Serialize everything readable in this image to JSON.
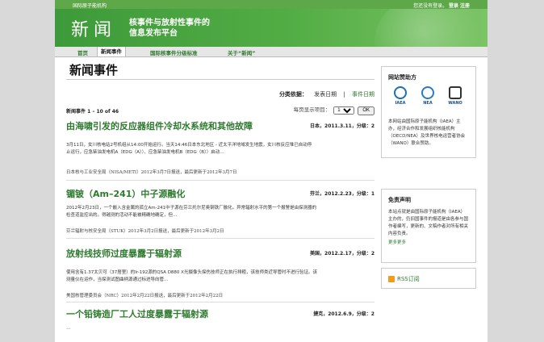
{
  "topbar": {
    "left_label": "国际原子能机构",
    "right_prefix": "您还没有登录。",
    "login": "登录",
    "register": "注册"
  },
  "banner": {
    "title": "新闻",
    "subtitle_line1": "核事件与放射性事件的",
    "subtitle_line2": "信息发布平台"
  },
  "nav": {
    "items": [
      "首页",
      "新闻事件",
      "国际核事件分级标准",
      "关于“新闻”"
    ],
    "active_index": 1
  },
  "main": {
    "heading": "新闻事件",
    "sort_label": "分类依据：",
    "sort_options": [
      "发表日期",
      "|",
      "事件日期"
    ],
    "count_text": "新闻事件 1 – 10 of 46",
    "per_page_label": "每页显示项目：",
    "per_page_value": "10",
    "ok_label": "OK",
    "items": [
      {
        "title": "由海啸引发的反应器组件冷却水系统和其他故障",
        "meta": "日本，2011.3.11，分级：2",
        "body_line1": "3月11日，女川核电站2号机组从14:00开始运行。当天14:46日本东北地区 - 近太平洋地域发生地震，女川核反应堆已自动停",
        "body_line2": "止运行，应急柴油发电机A（EDG（A））、应急柴油发电机B（EDG（B））启动…",
        "source": "日本核与工业安全局（NISA/METI）2012年3月7日报送，最后更新于2012年3月7日"
      },
      {
        "title": "镅铍（Am–241）中子源融化",
        "meta": "芬兰，2012.2.23，分级：1",
        "body_line1": "2012年2月23日，一个嵌入含金属的孤立Am-241中子源在芬兰托尔尼奥钢铁厂融化。异常辐射水平的第一个报警是由探测器的",
        "body_line2": "检查道监控出的。得越测的活动不能被精确地确定，但…",
        "source": "芬兰辐射与核安全局（STUK）2012年3月2日报送，最后更新于2012年3月2日"
      },
      {
        "title": "放射线技师过度暴露于辐射源",
        "meta": "美国，2012.2.17，分级：2",
        "body_line1": "使用含有1.37太贝可（37居里）的Ir-192源的QSA D880 X光摄像头探伤技师正在执行排粗，该技师类近导管时不进行验证。该",
        "body_line2": "测量仪在运作，当探测试图曲柄源通过标进导向管…",
        "source": "美国核管理委员会（NRC）2012年2月22日报送，最后更新于2012年2月22日"
      },
      {
        "title": "一个铅铸造厂工人过度暴露于辐射源",
        "meta": "捷克，2012.6.9，分级：2",
        "body_line1": "…",
        "body_line2": "",
        "source": ""
      }
    ]
  },
  "side": {
    "sponsor_title": "网站赞助方",
    "logos": [
      "IAEA",
      "NEA",
      "WANO"
    ],
    "sponsor_text": "本网站由国际原子能机构（IAEA）主办，经济合作和发展组织核能机构（OECD/NEA）及世界核电运营者协会（WANO）联合赞助。",
    "disclaimer_title": "免责声明",
    "disclaimer_text": "本站点就是由国际原子能机构（IAEA）主办的，仍旧国事件的报道是由各参与国作者编写，更新的、文稿作者对所有相关内容负责。",
    "disclaimer_more": "更多更多",
    "rss_label": "RSS订阅"
  },
  "colors": {
    "brand_green": "#53ad45",
    "link_green": "#2e7a2e"
  }
}
